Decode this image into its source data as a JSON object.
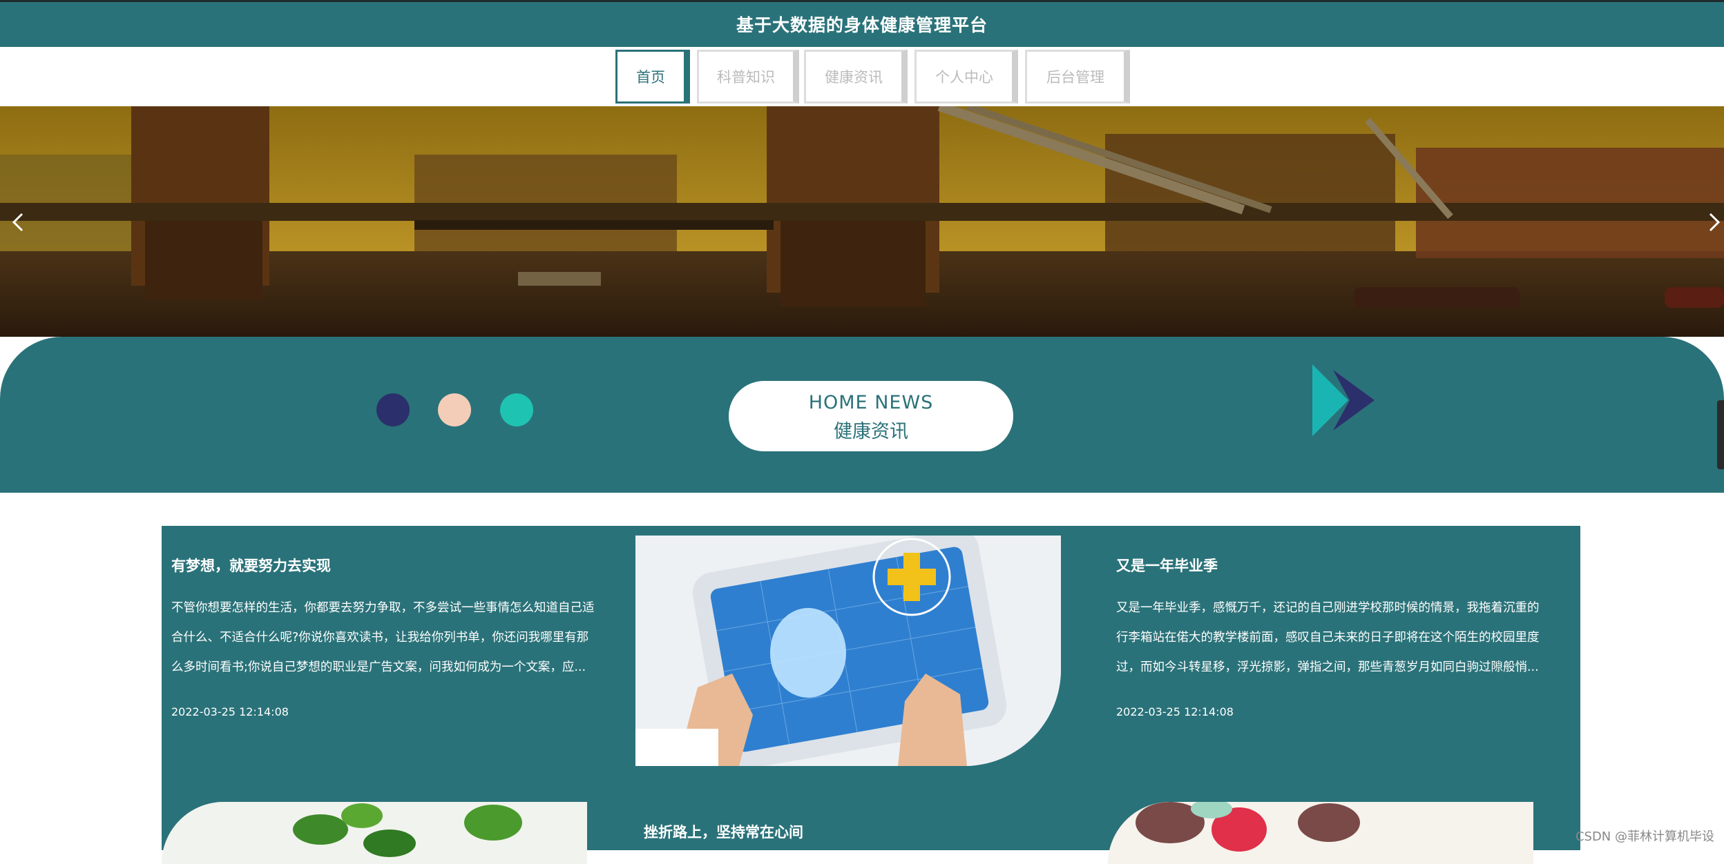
{
  "header": {
    "title": "基于大数据的身体健康管理平台"
  },
  "nav": {
    "items": [
      {
        "label": "首页",
        "active": true
      },
      {
        "label": "科普知识",
        "active": false
      },
      {
        "label": "健康资讯",
        "active": false
      },
      {
        "label": "个人中心",
        "active": false
      },
      {
        "label": "后台管理",
        "active": false
      }
    ]
  },
  "banner": {
    "prev_icon": "chevron-left-icon",
    "next_icon": "chevron-right-icon"
  },
  "news_section": {
    "heading_en": "HOME NEWS",
    "heading_cn": "健康资讯",
    "dot_colors": [
      "#2b2f6b",
      "#f4cdb8",
      "#1fc3b1"
    ]
  },
  "news": [
    {
      "title": "有梦想，就要努力去实现",
      "excerpt_lines": [
        "不管你想要怎样的生活，你都要去努力争取，不多尝试一些事情怎么知道自己适",
        "合什么、不适合什么呢?你说你喜欢读书，让我给你列书单，你还问我哪里有那",
        "么多时间看书;你说自己梦想的职业是广告文案，问我如何成为一个文案，应..."
      ],
      "date": "2022-03-25 12:14:08"
    },
    {
      "title": "又是一年毕业季",
      "excerpt_lines": [
        "又是一年毕业季，感慨万千，还记的自己刚进学校那时候的情景，我拖着沉重的",
        "行李箱站在偌大的教学楼前面，感叹自己未来的日子即将在这个陌生的校园里度",
        "过，而如今斗转星移，浮光掠影，弹指之间，那些青葱岁月如同白驹过隙般悄..."
      ],
      "date": "2022-03-25 12:14:08"
    },
    {
      "title": "挫折路上，坚持常在心间"
    }
  ],
  "watermark": "CSDN @菲林计算机毕设",
  "colors": {
    "primary": "#2a7279",
    "white": "#ffffff"
  }
}
